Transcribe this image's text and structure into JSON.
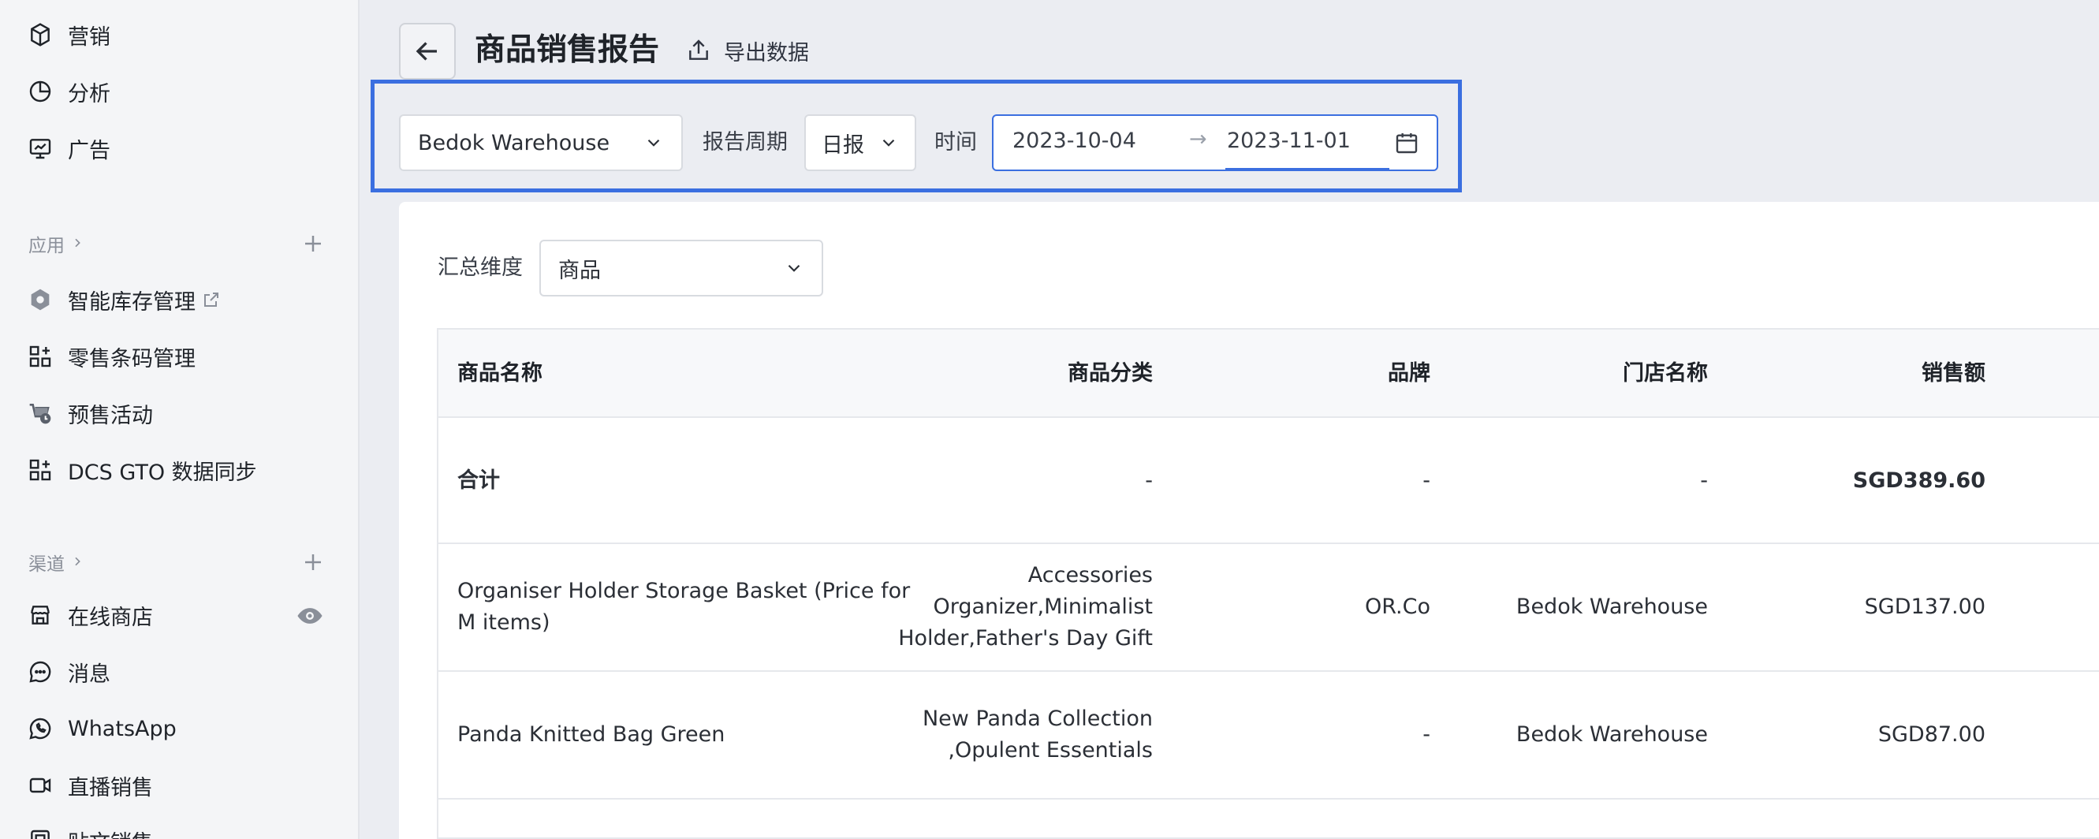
{
  "sidebar": {
    "top_items": [
      {
        "label": "营销",
        "icon": "box-icon"
      },
      {
        "label": "分析",
        "icon": "pie-chart-icon"
      },
      {
        "label": "广告",
        "icon": "monitor-icon"
      }
    ],
    "apps_section": {
      "label": "应用",
      "chevron": "chevron-right-icon"
    },
    "apps": [
      {
        "label": "智能库存管理",
        "icon": "hexagon-icon",
        "external": "external-link-icon"
      },
      {
        "label": "零售条码管理",
        "icon": "apps-grid-icon"
      },
      {
        "label": "预售活动",
        "icon": "cart-clock-icon"
      },
      {
        "label": "DCS GTO 数据同步",
        "icon": "apps-grid-icon"
      }
    ],
    "channels_section": {
      "label": "渠道",
      "chevron": "chevron-right-icon"
    },
    "channels": [
      {
        "label": "在线商店",
        "icon": "store-icon"
      },
      {
        "label": "消息",
        "icon": "chat-icon"
      },
      {
        "label": "WhatsApp",
        "icon": "whatsapp-icon"
      },
      {
        "label": "直播销售",
        "icon": "video-icon"
      },
      {
        "label": "贴文销售",
        "icon": "post-icon"
      }
    ]
  },
  "header": {
    "title": "商品销售报告",
    "export_label": "导出数据"
  },
  "filters": {
    "warehouse": "Bedok Warehouse",
    "period_label": "报告周期",
    "period_value": "日报",
    "time_label": "时间",
    "date_from": "2023-10-04",
    "date_arrow": "→",
    "date_to": "2023-11-01"
  },
  "summary": {
    "dimension_label": "汇总维度",
    "dimension_value": "商品"
  },
  "table": {
    "headers": [
      "商品名称",
      "商品分类",
      "品牌",
      "门店名称",
      "销售额"
    ],
    "total": {
      "name": "合计",
      "category": "-",
      "brand": "-",
      "store": "-",
      "sales": "SGD389.60"
    },
    "rows": [
      {
        "name_line1": "Organiser Holder Storage Basket (Price for",
        "name_line2": "M items)",
        "category_line1": "Accessories",
        "category_line2": "Organizer,Minimalist",
        "category_line3": "Holder,Father's Day Gift",
        "brand": "OR.Co",
        "store": "Bedok Warehouse",
        "sales": "SGD137.00"
      },
      {
        "name_line1": "Panda Knitted Bag Green",
        "category_line1": "New Panda Collection",
        "category_line2": ",Opulent Essentials",
        "brand": "-",
        "store": "Bedok Warehouse",
        "sales": "SGD87.00"
      }
    ]
  },
  "colors": {
    "accent": "#3b6fe0",
    "sidebar_bg": "#f4f5f7",
    "page_bg": "#ebedf2"
  }
}
